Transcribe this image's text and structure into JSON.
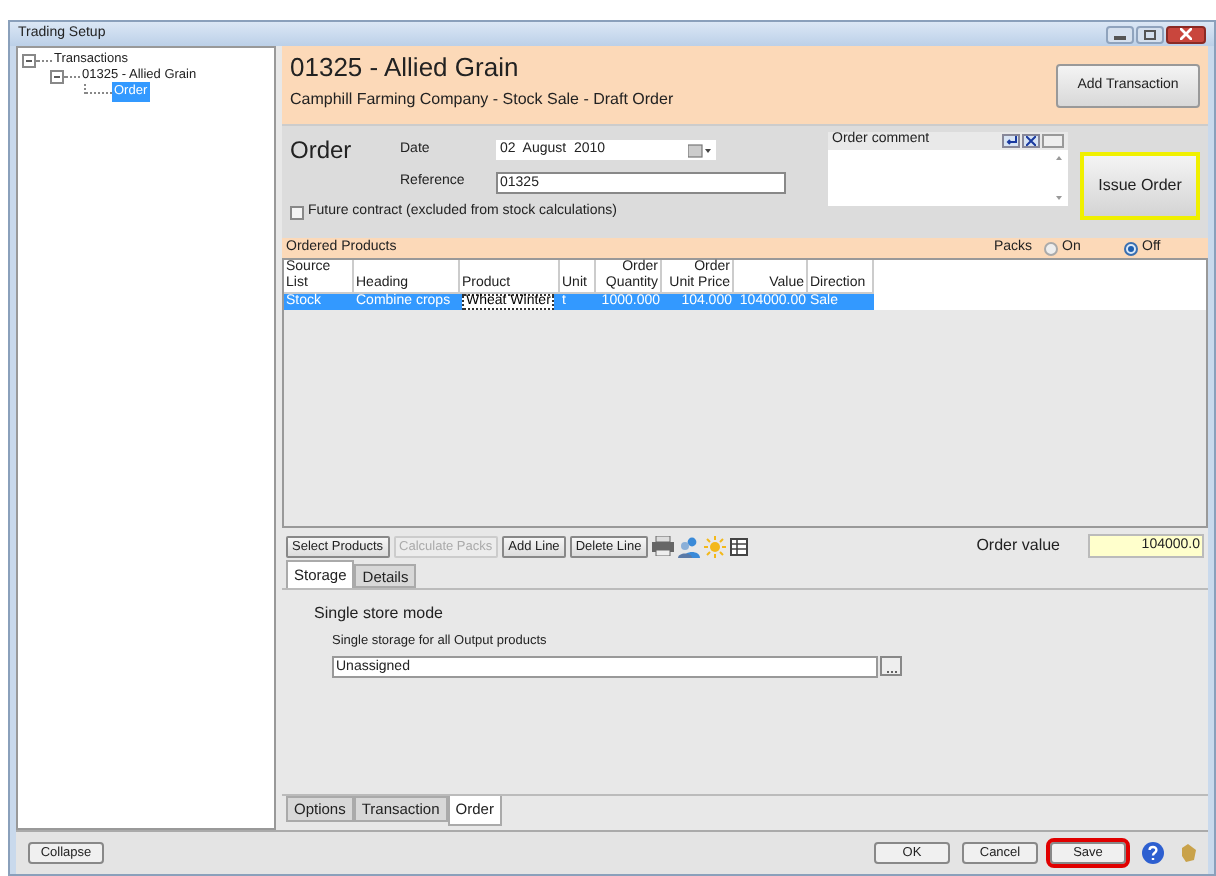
{
  "window": {
    "title": "Trading Setup"
  },
  "tree": [
    {
      "label": "Transactions",
      "expanded": true,
      "selected": false,
      "children": [
        {
          "label": "01325 - Allied Grain",
          "expanded": true,
          "selected": false,
          "children": [
            {
              "label": "Order",
              "selected": true
            }
          ]
        }
      ]
    }
  ],
  "header": {
    "title": "01325 - Allied Grain",
    "subtitle": "Camphill Farming Company - Stock Sale - Draft Order",
    "add_button": "Add Transaction"
  },
  "order": {
    "heading": "Order",
    "date_label": "Date",
    "date": "02  August  2010",
    "reference_label": "Reference",
    "reference": "01325",
    "future_contract": {
      "label": "Future contract (excluded from stock calculations)",
      "checked": false
    },
    "comment_label": "Order comment",
    "issue_button": "Issue Order"
  },
  "products": {
    "title": "Ordered Products",
    "packs_label": "Packs",
    "packs_options": [
      {
        "label": "On",
        "selected": false
      },
      {
        "label": "Off",
        "selected": true
      }
    ],
    "columns": [
      "Source List",
      "Heading",
      "Product",
      "Unit",
      "Order\nQuantity",
      "Order\nUnit Price",
      "Value",
      "Direction"
    ],
    "rows": [
      {
        "cells": [
          "Stock",
          "Combine crops",
          "Wheat Winter",
          "t",
          "1000.000",
          "104.000",
          "104000.00",
          "Sale"
        ],
        "selected": true
      }
    ]
  },
  "toolbar": [
    {
      "label": "Select Products",
      "disabled": false
    },
    {
      "label": "Calculate Packs",
      "disabled": true
    },
    {
      "label": "Add Line",
      "disabled": false
    },
    {
      "label": "Delete Line",
      "disabled": false
    }
  ],
  "order_value": {
    "label": "Order value",
    "value": "104000.0"
  },
  "storage_tabs": [
    {
      "label": "Storage",
      "selected": true
    },
    {
      "label": "Details",
      "selected": false
    }
  ],
  "storage": {
    "mode": "Single store mode",
    "field_label": "Single storage for all Output products",
    "value": "Unassigned"
  },
  "bottom_tabs": [
    {
      "label": "Options",
      "selected": false
    },
    {
      "label": "Transaction",
      "selected": false
    },
    {
      "label": "Order",
      "selected": true
    }
  ],
  "collapse_button": "Collapse",
  "footer_buttons": [
    {
      "label": "OK",
      "highlighted": false
    },
    {
      "label": "Cancel",
      "highlighted": false
    },
    {
      "label": "Save",
      "highlighted": true
    }
  ]
}
